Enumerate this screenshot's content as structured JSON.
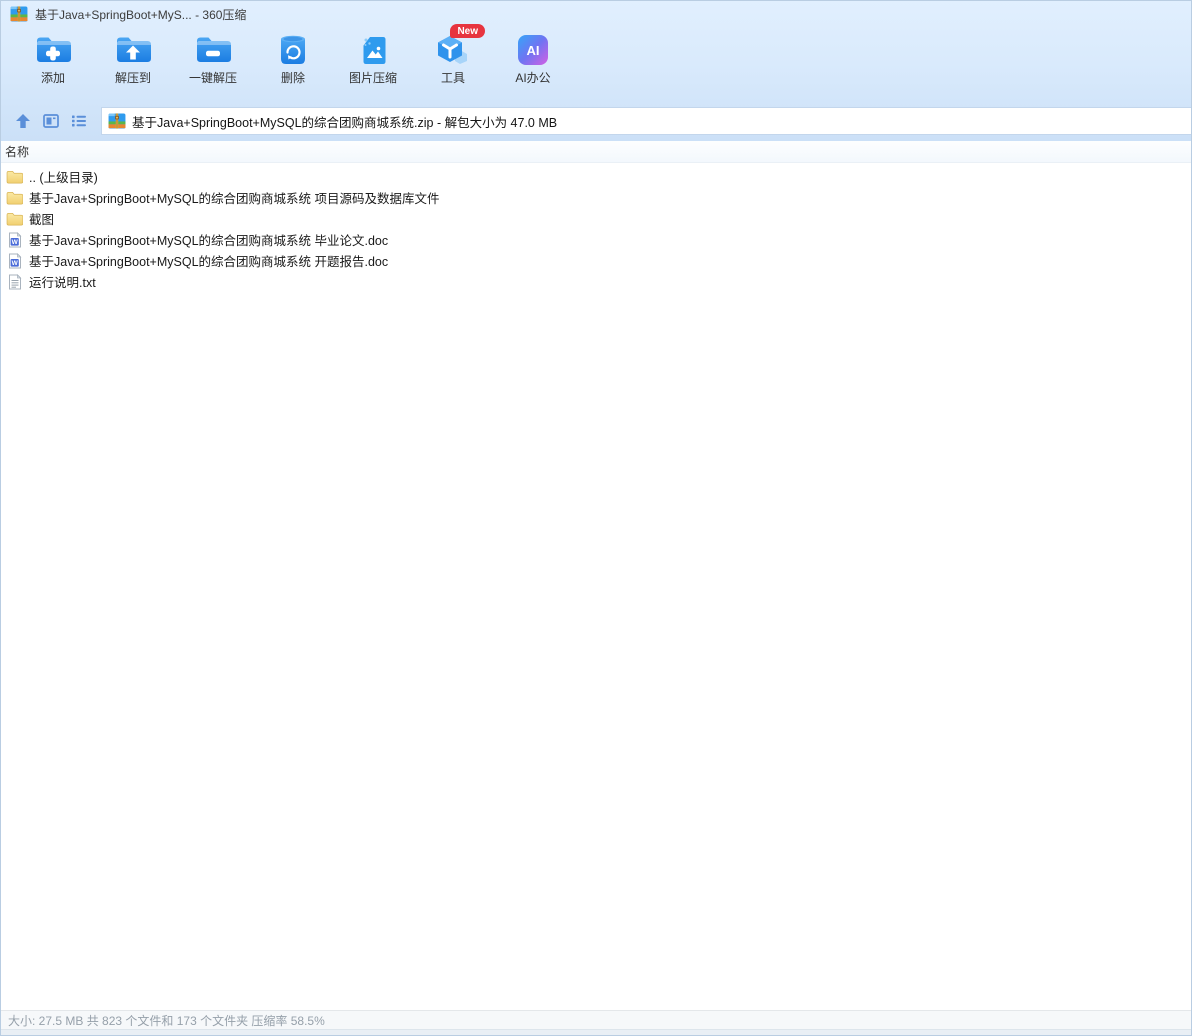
{
  "window": {
    "title": "基于Java+SpringBoot+MyS... - 360压缩"
  },
  "toolbar": {
    "buttons": [
      {
        "label": "添加",
        "icon": "folder-plus-icon"
      },
      {
        "label": "解压到",
        "icon": "folder-up-arrow-icon"
      },
      {
        "label": "一键解压",
        "icon": "folder-minus-icon"
      },
      {
        "label": "删除",
        "icon": "trash-recycle-icon"
      },
      {
        "label": "图片压缩",
        "icon": "image-compress-icon"
      },
      {
        "label": "工具",
        "icon": "tools-cube-icon",
        "badge": "New"
      },
      {
        "label": "AI办公",
        "icon": "ai-chip-icon",
        "chip_text": "AI"
      }
    ]
  },
  "addressbar": {
    "path": "基于Java+SpringBoot+MySQL的综合团购商城系统.zip - 解包大小为 47.0 MB"
  },
  "list": {
    "header_name": "名称",
    "rows": [
      {
        "name": ".. (上级目录)",
        "type": "folder"
      },
      {
        "name": "基于Java+SpringBoot+MySQL的综合团购商城系统 项目源码及数据库文件",
        "type": "folder"
      },
      {
        "name": "截图",
        "type": "folder"
      },
      {
        "name": "基于Java+SpringBoot+MySQL的综合团购商城系统 毕业论文.doc",
        "type": "doc"
      },
      {
        "name": "基于Java+SpringBoot+MySQL的综合团购商城系统 开题报告.doc",
        "type": "doc"
      },
      {
        "name": "运行说明.txt",
        "type": "txt"
      }
    ]
  },
  "statusbar": {
    "text": "大小: 27.5 MB 共 823 个文件和 173 个文件夹 压缩率 58.5%"
  },
  "colors": {
    "accent_blue": "#2d97ef",
    "nav_icon_blue": "#5a8fd9",
    "badge_red": "#e7343f",
    "folder_yellow": "#f4d77c",
    "chrome_top": "#e1effe",
    "chrome_bottom": "#cbe0f7"
  }
}
